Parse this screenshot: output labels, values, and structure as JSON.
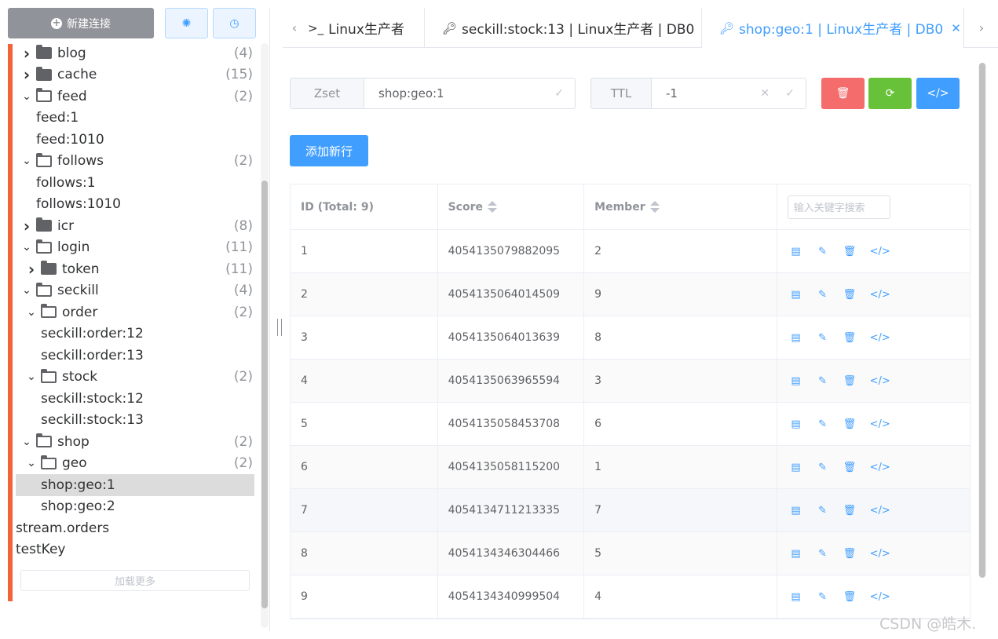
{
  "sidebar": {
    "new_conn_label": "新建连接",
    "load_more_label": "加载更多",
    "tree": [
      {
        "label": "blog",
        "count": "(4)",
        "caret": "›",
        "folder": "closed",
        "indent": 0
      },
      {
        "label": "cache",
        "count": "(15)",
        "caret": "›",
        "folder": "closed",
        "indent": 0
      },
      {
        "label": "feed",
        "count": "(2)",
        "caret": "⌄",
        "folder": "open",
        "indent": 0
      },
      {
        "label": "feed:1",
        "count": "",
        "caret": "",
        "folder": "",
        "indent": 1
      },
      {
        "label": "feed:1010",
        "count": "",
        "caret": "",
        "folder": "",
        "indent": 1
      },
      {
        "label": "follows",
        "count": "(2)",
        "caret": "⌄",
        "folder": "open",
        "indent": 0
      },
      {
        "label": "follows:1",
        "count": "",
        "caret": "",
        "folder": "",
        "indent": 1
      },
      {
        "label": "follows:1010",
        "count": "",
        "caret": "",
        "folder": "",
        "indent": 1
      },
      {
        "label": "icr",
        "count": "(8)",
        "caret": "›",
        "folder": "closed",
        "indent": 0
      },
      {
        "label": "login",
        "count": "(11)",
        "caret": "⌄",
        "folder": "open",
        "indent": 0
      },
      {
        "label": "token",
        "count": "(11)",
        "caret": "›",
        "folder": "closed",
        "indent": 2
      },
      {
        "label": "seckill",
        "count": "(4)",
        "caret": "⌄",
        "folder": "open",
        "indent": 0
      },
      {
        "label": "order",
        "count": "(2)",
        "caret": "⌄",
        "folder": "open",
        "indent": 2
      },
      {
        "label": "seckill:order:12",
        "count": "",
        "caret": "",
        "folder": "",
        "indent": 3
      },
      {
        "label": "seckill:order:13",
        "count": "",
        "caret": "",
        "folder": "",
        "indent": 3
      },
      {
        "label": "stock",
        "count": "(2)",
        "caret": "⌄",
        "folder": "open",
        "indent": 2
      },
      {
        "label": "seckill:stock:12",
        "count": "",
        "caret": "",
        "folder": "",
        "indent": 3
      },
      {
        "label": "seckill:stock:13",
        "count": "",
        "caret": "",
        "folder": "",
        "indent": 3
      },
      {
        "label": "shop",
        "count": "(2)",
        "caret": "⌄",
        "folder": "open",
        "indent": 0
      },
      {
        "label": "geo",
        "count": "(2)",
        "caret": "⌄",
        "folder": "open",
        "indent": 2
      },
      {
        "label": "shop:geo:1",
        "count": "",
        "caret": "",
        "folder": "",
        "indent": 3,
        "selected": true
      },
      {
        "label": "shop:geo:2",
        "count": "",
        "caret": "",
        "folder": "",
        "indent": 3
      },
      {
        "label": "stream.orders",
        "count": "",
        "caret": "",
        "folder": "",
        "indent": 4
      },
      {
        "label": "testKey",
        "count": "",
        "caret": "",
        "folder": "",
        "indent": 4
      }
    ]
  },
  "tabs": [
    {
      "label": "Linux生产者",
      "icon": ">_"
    },
    {
      "label": "seckill:stock:13 | Linux生产者 | DB0",
      "icon": "key"
    },
    {
      "label": "shop:geo:1 | Linux生产者 | DB0",
      "icon": "key",
      "active": true
    }
  ],
  "key": {
    "type_label": "Zset",
    "name": "shop:geo:1",
    "ttl_label": "TTL",
    "ttl_value": "-1"
  },
  "add_row_label": "添加新行",
  "table": {
    "col_id": "ID (Total: 9)",
    "col_score": "Score",
    "col_member": "Member",
    "search_placeholder": "输入关键字搜索",
    "rows": [
      {
        "id": "1",
        "score": "4054135079882095",
        "member": "2"
      },
      {
        "id": "2",
        "score": "4054135064014509",
        "member": "9"
      },
      {
        "id": "3",
        "score": "4054135064013639",
        "member": "8"
      },
      {
        "id": "4",
        "score": "4054135063965594",
        "member": "3"
      },
      {
        "id": "5",
        "score": "4054135058453708",
        "member": "6"
      },
      {
        "id": "6",
        "score": "4054135058115200",
        "member": "1"
      },
      {
        "id": "7",
        "score": "4054134711213335",
        "member": "7"
      },
      {
        "id": "8",
        "score": "4054134346304466",
        "member": "5"
      },
      {
        "id": "9",
        "score": "4054134340999504",
        "member": "4"
      }
    ]
  },
  "watermark": "CSDN @皓木.",
  "colors": {
    "accent": "#409eff",
    "danger": "#f56c6c",
    "success": "#67c23a",
    "sidebar_bar": "#f4623a"
  }
}
